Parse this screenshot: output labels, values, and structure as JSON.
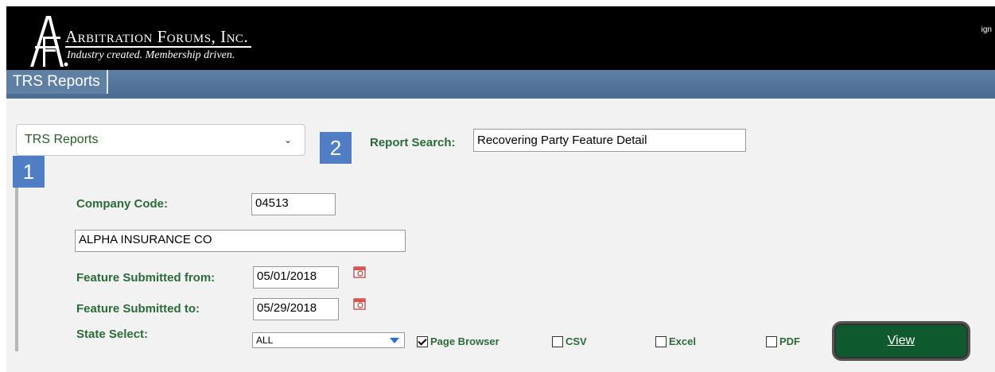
{
  "header": {
    "brand_title": "Arbitration Forums, Inc.",
    "tagline": "Industry created. Membership driven.",
    "top_right_link": "ign"
  },
  "banner": {
    "title": "TRS Reports"
  },
  "report_selector": {
    "selected": "TRS Reports"
  },
  "steps": {
    "one": "1",
    "two": "2"
  },
  "report_search": {
    "label": "Report Search:",
    "value": "Recovering Party Feature Detail"
  },
  "company_code": {
    "label": "Company Code:",
    "value": "04513"
  },
  "company_name": {
    "value": "ALPHA INSURANCE CO"
  },
  "feature_from": {
    "label": "Feature Submitted from:",
    "value": "05/01/2018"
  },
  "feature_to": {
    "label": "Feature Submitted to:",
    "value": "05/29/2018"
  },
  "state_select": {
    "label": "State Select:",
    "value": "ALL"
  },
  "outputs": {
    "page_browser": {
      "label": "Page Browser",
      "checked": true
    },
    "csv": {
      "label": "CSV",
      "checked": false
    },
    "excel": {
      "label": "Excel",
      "checked": false
    },
    "pdf": {
      "label": "PDF",
      "checked": false
    }
  },
  "view_button": {
    "label": "View"
  },
  "colors": {
    "accent_green": "#2c6a3a",
    "step_blue": "#4f7ec5",
    "banner_blue": "#5f7fa3",
    "view_green": "#0e5a2e"
  }
}
